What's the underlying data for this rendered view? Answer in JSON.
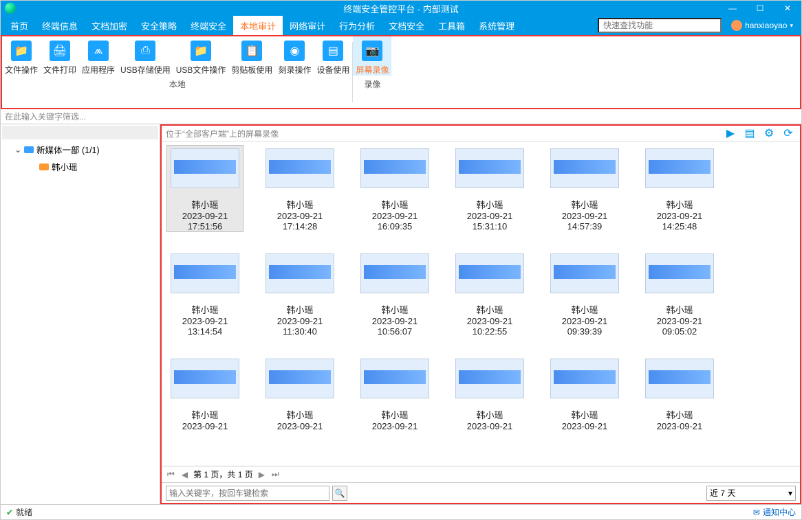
{
  "title": "终端安全管控平台 - 内部测试",
  "menus": [
    "首页",
    "终端信息",
    "文档加密",
    "安全策略",
    "终端安全",
    "本地审计",
    "网络审计",
    "行为分析",
    "文档安全",
    "工具箱",
    "系统管理"
  ],
  "menu_active_index": 5,
  "search_placeholder": "快速查找功能",
  "user": "hanxiaoyao",
  "ribbon": {
    "groups": [
      {
        "label": "本地",
        "tools": [
          {
            "label": "文件操作",
            "icon": "folder"
          },
          {
            "label": "文件打印",
            "icon": "print"
          },
          {
            "label": "应用程序",
            "icon": "app"
          },
          {
            "label": "USB存储使用",
            "icon": "usb"
          },
          {
            "label": "USB文件操作",
            "icon": "usbfile"
          },
          {
            "label": "剪贴板使用",
            "icon": "clip"
          },
          {
            "label": "刻录操作",
            "icon": "disc"
          },
          {
            "label": "设备使用",
            "icon": "dev"
          }
        ]
      },
      {
        "label": "录像",
        "tools": [
          {
            "label": "屏幕录像",
            "icon": "cam",
            "selected": true
          }
        ]
      }
    ]
  },
  "filter_placeholder": "在此输入关键字筛选...",
  "tree": {
    "group": "新媒体一部 (1/1)",
    "child": "韩小瑶"
  },
  "crumb": "位于“全部客户端”上的屏幕录像",
  "cards": [
    {
      "name": "韩小瑶",
      "date": "2023-09-21",
      "time": "17:51:56",
      "sel": true
    },
    {
      "name": "韩小瑶",
      "date": "2023-09-21",
      "time": "17:14:28"
    },
    {
      "name": "韩小瑶",
      "date": "2023-09-21",
      "time": "16:09:35"
    },
    {
      "name": "韩小瑶",
      "date": "2023-09-21",
      "time": "15:31:10"
    },
    {
      "name": "韩小瑶",
      "date": "2023-09-21",
      "time": "14:57:39"
    },
    {
      "name": "韩小瑶",
      "date": "2023-09-21",
      "time": "14:25:48"
    },
    {
      "name": "韩小瑶",
      "date": "2023-09-21",
      "time": "13:14:54"
    },
    {
      "name": "韩小瑶",
      "date": "2023-09-21",
      "time": "11:30:40"
    },
    {
      "name": "韩小瑶",
      "date": "2023-09-21",
      "time": "10:56:07"
    },
    {
      "name": "韩小瑶",
      "date": "2023-09-21",
      "time": "10:22:55"
    },
    {
      "name": "韩小瑶",
      "date": "2023-09-21",
      "time": "09:39:39"
    },
    {
      "name": "韩小瑶",
      "date": "2023-09-21",
      "time": "09:05:02"
    },
    {
      "name": "韩小瑶",
      "date": "2023-09-21",
      "time": ""
    },
    {
      "name": "韩小瑶",
      "date": "2023-09-21",
      "time": ""
    },
    {
      "name": "韩小瑶",
      "date": "2023-09-21",
      "time": ""
    },
    {
      "name": "韩小瑶",
      "date": "2023-09-21",
      "time": ""
    },
    {
      "name": "韩小瑶",
      "date": "2023-09-21",
      "time": ""
    },
    {
      "name": "韩小瑶",
      "date": "2023-09-21",
      "time": ""
    }
  ],
  "pager_text": "第 1 页，共 1 页",
  "search_hint": "输入关键字，按回车键检索",
  "range_select": "近 7 天",
  "status": "就绪",
  "notify": "通知中心"
}
